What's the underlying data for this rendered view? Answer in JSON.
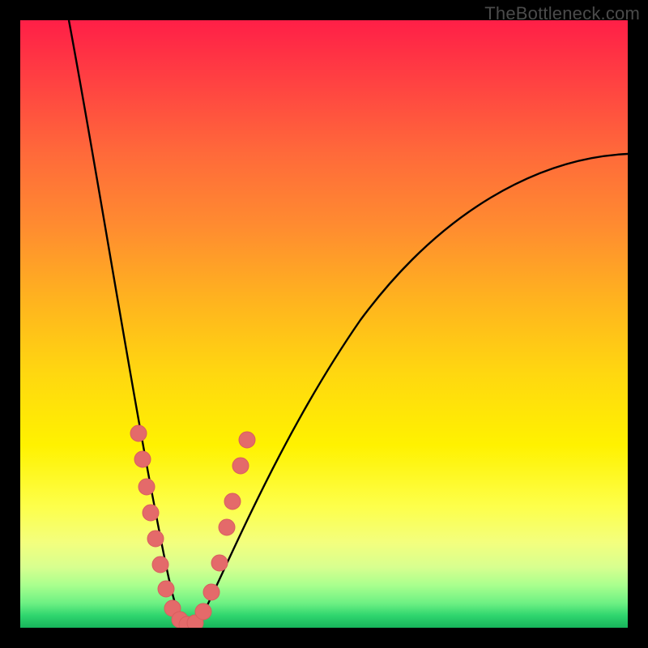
{
  "watermark": "TheBottleneck.com",
  "colors": {
    "curve_stroke": "#000000",
    "marker_fill": "#e46a6a",
    "marker_stroke": "#d85e5e",
    "frame_border": "#000000"
  },
  "chart_data": {
    "type": "line",
    "title": "",
    "xlabel": "",
    "ylabel": "",
    "xlim": [
      0,
      100
    ],
    "ylim": [
      0,
      100
    ],
    "x_min_at": 26,
    "curve": {
      "description": "V-shaped bottleneck curve with a steep left arm and a shallower right arm meeting near x≈26, y≈0",
      "left_arm_start": {
        "x": 8,
        "y": 100
      },
      "right_arm_end": {
        "x": 100,
        "y": 78
      },
      "minimum": {
        "x": 26,
        "y": 0
      }
    },
    "series": [
      {
        "name": "markers",
        "points": [
          {
            "x": 19.0,
            "y": 32
          },
          {
            "x": 19.8,
            "y": 28
          },
          {
            "x": 20.5,
            "y": 23
          },
          {
            "x": 21.2,
            "y": 19
          },
          {
            "x": 21.8,
            "y": 15
          },
          {
            "x": 22.7,
            "y": 11
          },
          {
            "x": 23.5,
            "y": 7
          },
          {
            "x": 24.5,
            "y": 3.5
          },
          {
            "x": 25.5,
            "y": 1.5
          },
          {
            "x": 26.5,
            "y": 0.5
          },
          {
            "x": 27.8,
            "y": 0.7
          },
          {
            "x": 29.0,
            "y": 2.5
          },
          {
            "x": 30.3,
            "y": 6
          },
          {
            "x": 31.5,
            "y": 11
          },
          {
            "x": 32.7,
            "y": 17
          },
          {
            "x": 33.5,
            "y": 21
          },
          {
            "x": 34.8,
            "y": 27
          },
          {
            "x": 35.8,
            "y": 31
          }
        ]
      }
    ]
  }
}
